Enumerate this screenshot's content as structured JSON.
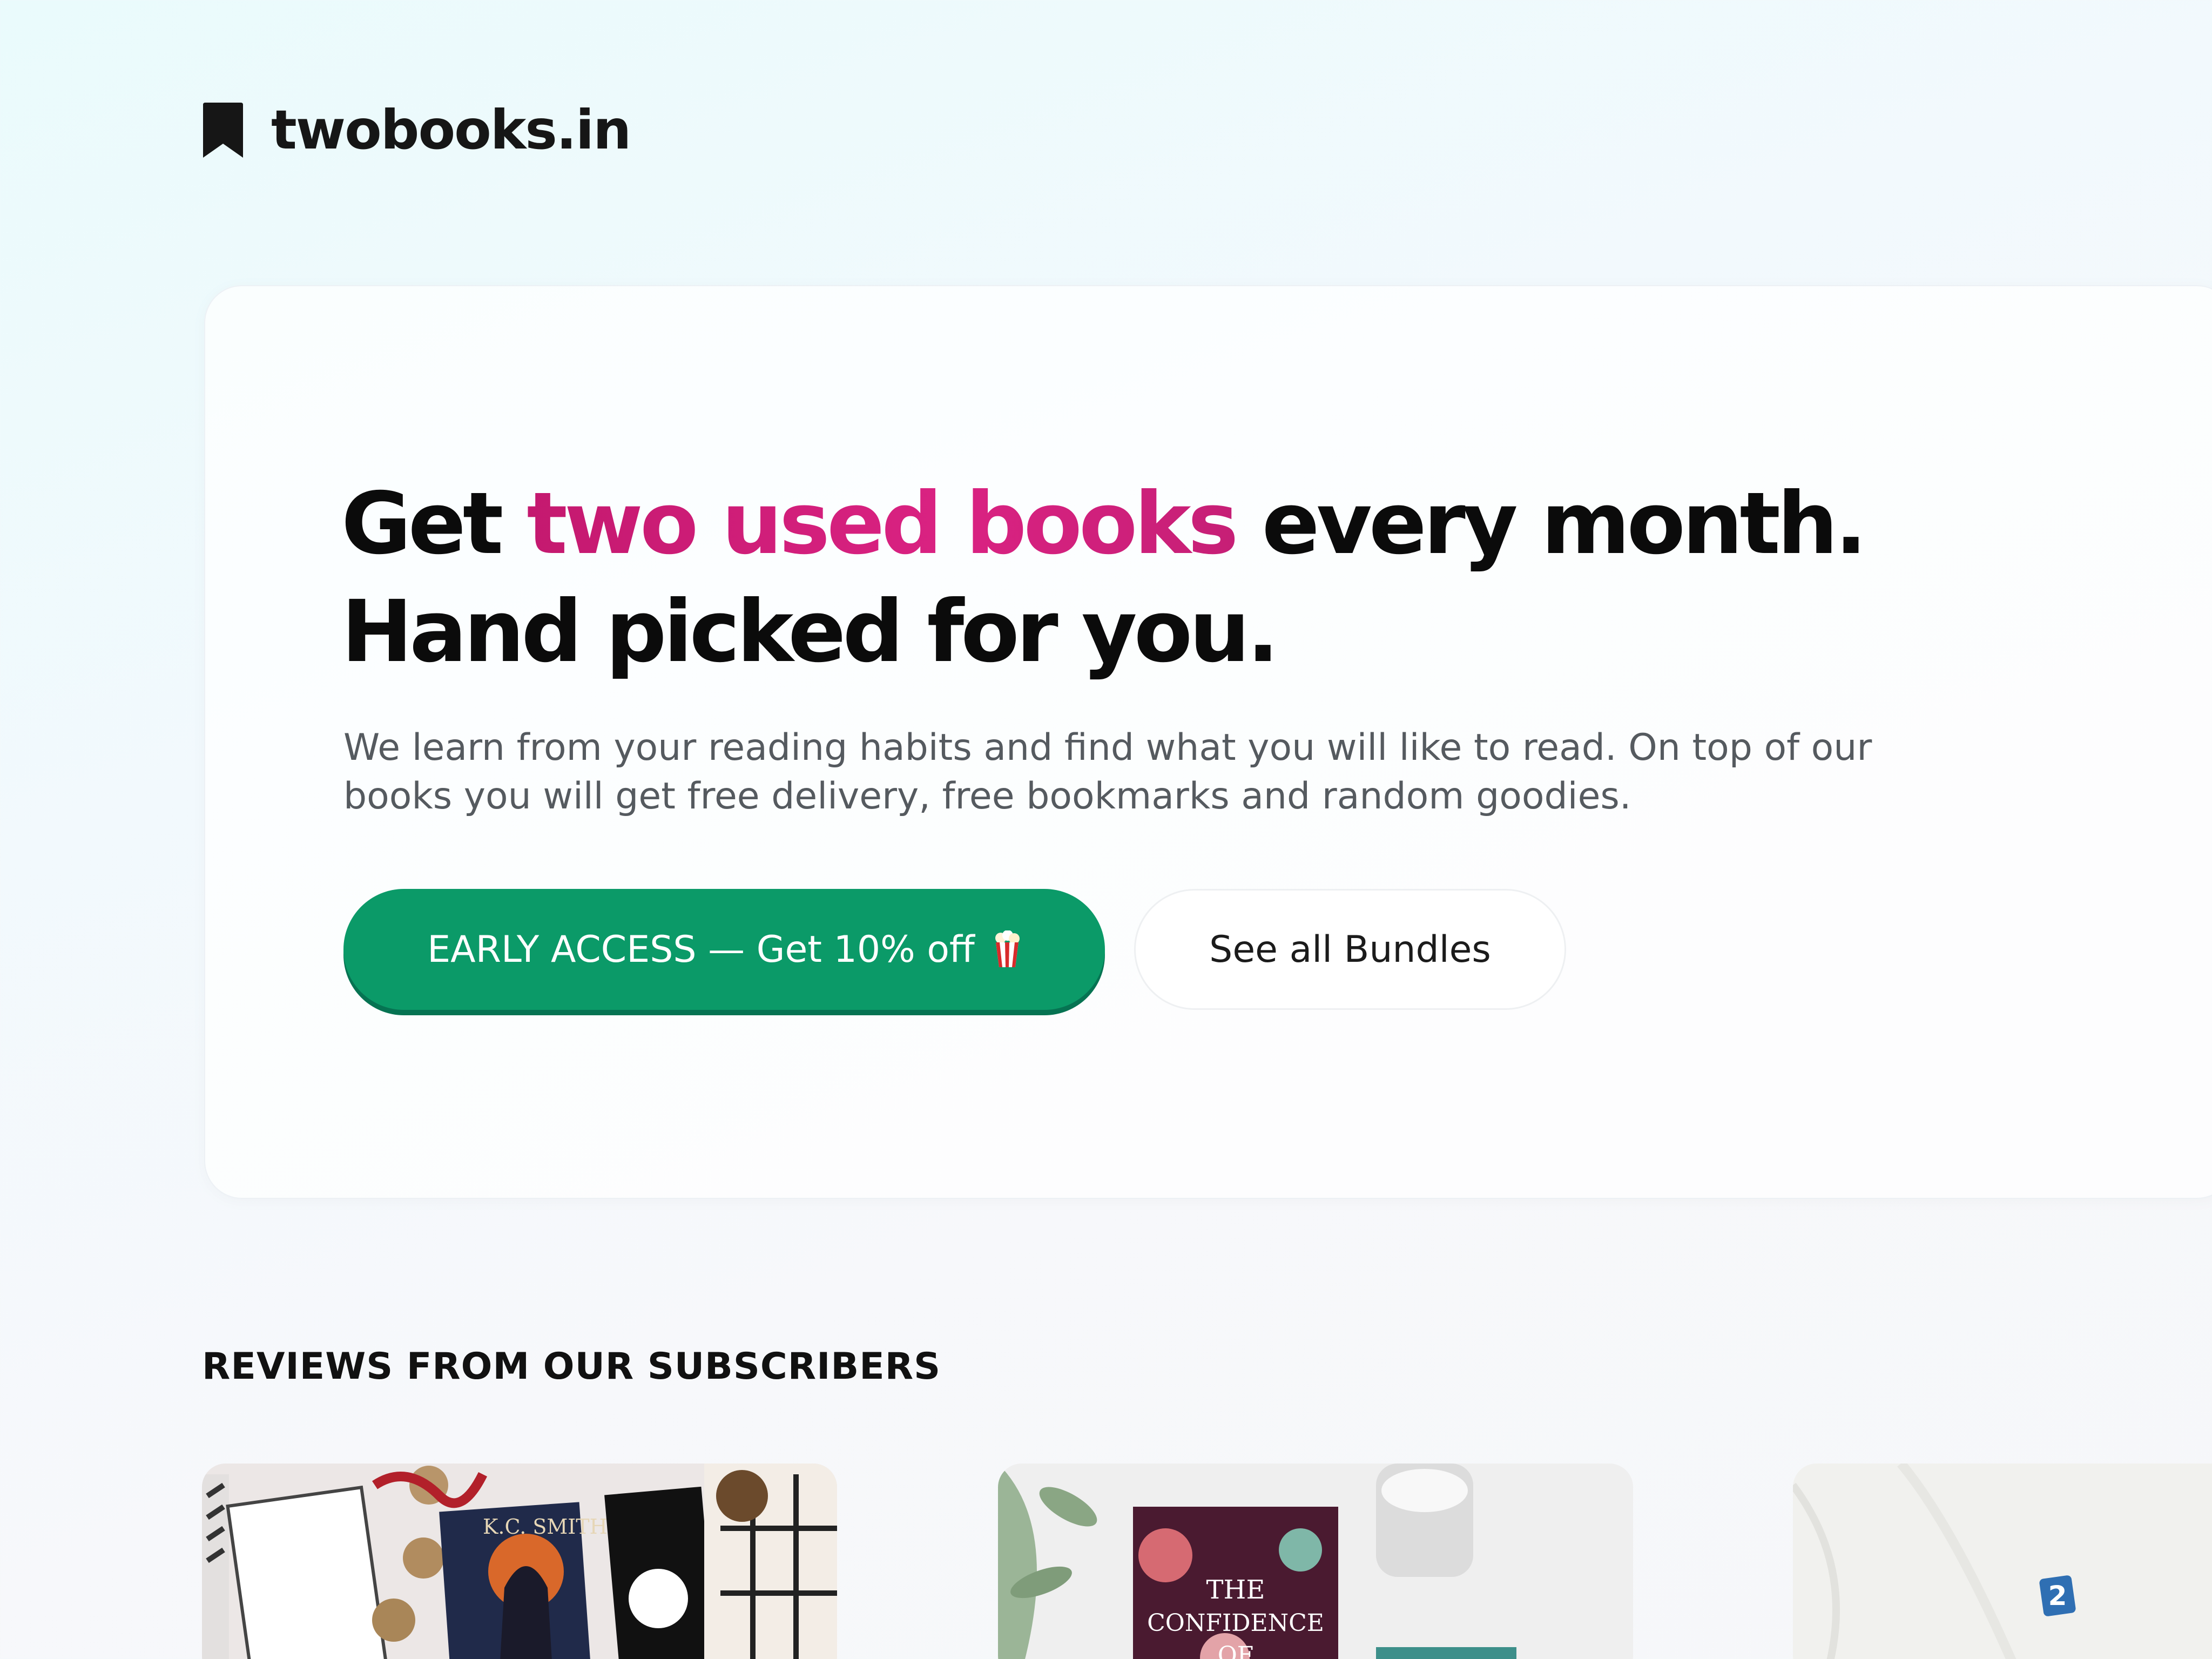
{
  "brand": {
    "name": "twobooks.in",
    "logo_icon": "bookmark-icon"
  },
  "hero": {
    "title_part1": "Get ",
    "title_highlight": "two used books",
    "title_part2": " every month.",
    "title_line2": "Hand picked for you.",
    "subtitle": "We learn from your reading habits and find what you will like to read. On top of our books you will get free delivery, free bookmarks and random goodies.",
    "primary_button": {
      "label": "EARLY ACCESS — Get 10% off",
      "icon": "popcorn-icon"
    },
    "secondary_button": {
      "label": "See all Bundles"
    }
  },
  "reviews": {
    "title": "REVIEWS FROM OUR SUBSCRIBERS",
    "cards": [
      {
        "image": "review-photo-1",
        "book_author_text": "K.C. SMITH"
      },
      {
        "image": "review-photo-2",
        "book_title_text": "THE CONFIDENCE OF"
      },
      {
        "image": "review-photo-3"
      }
    ]
  },
  "colors": {
    "accent_pink": "#d11a78",
    "primary_green": "#0b9a68",
    "text_dark": "#0b0b0b",
    "text_muted": "#555a5f"
  }
}
